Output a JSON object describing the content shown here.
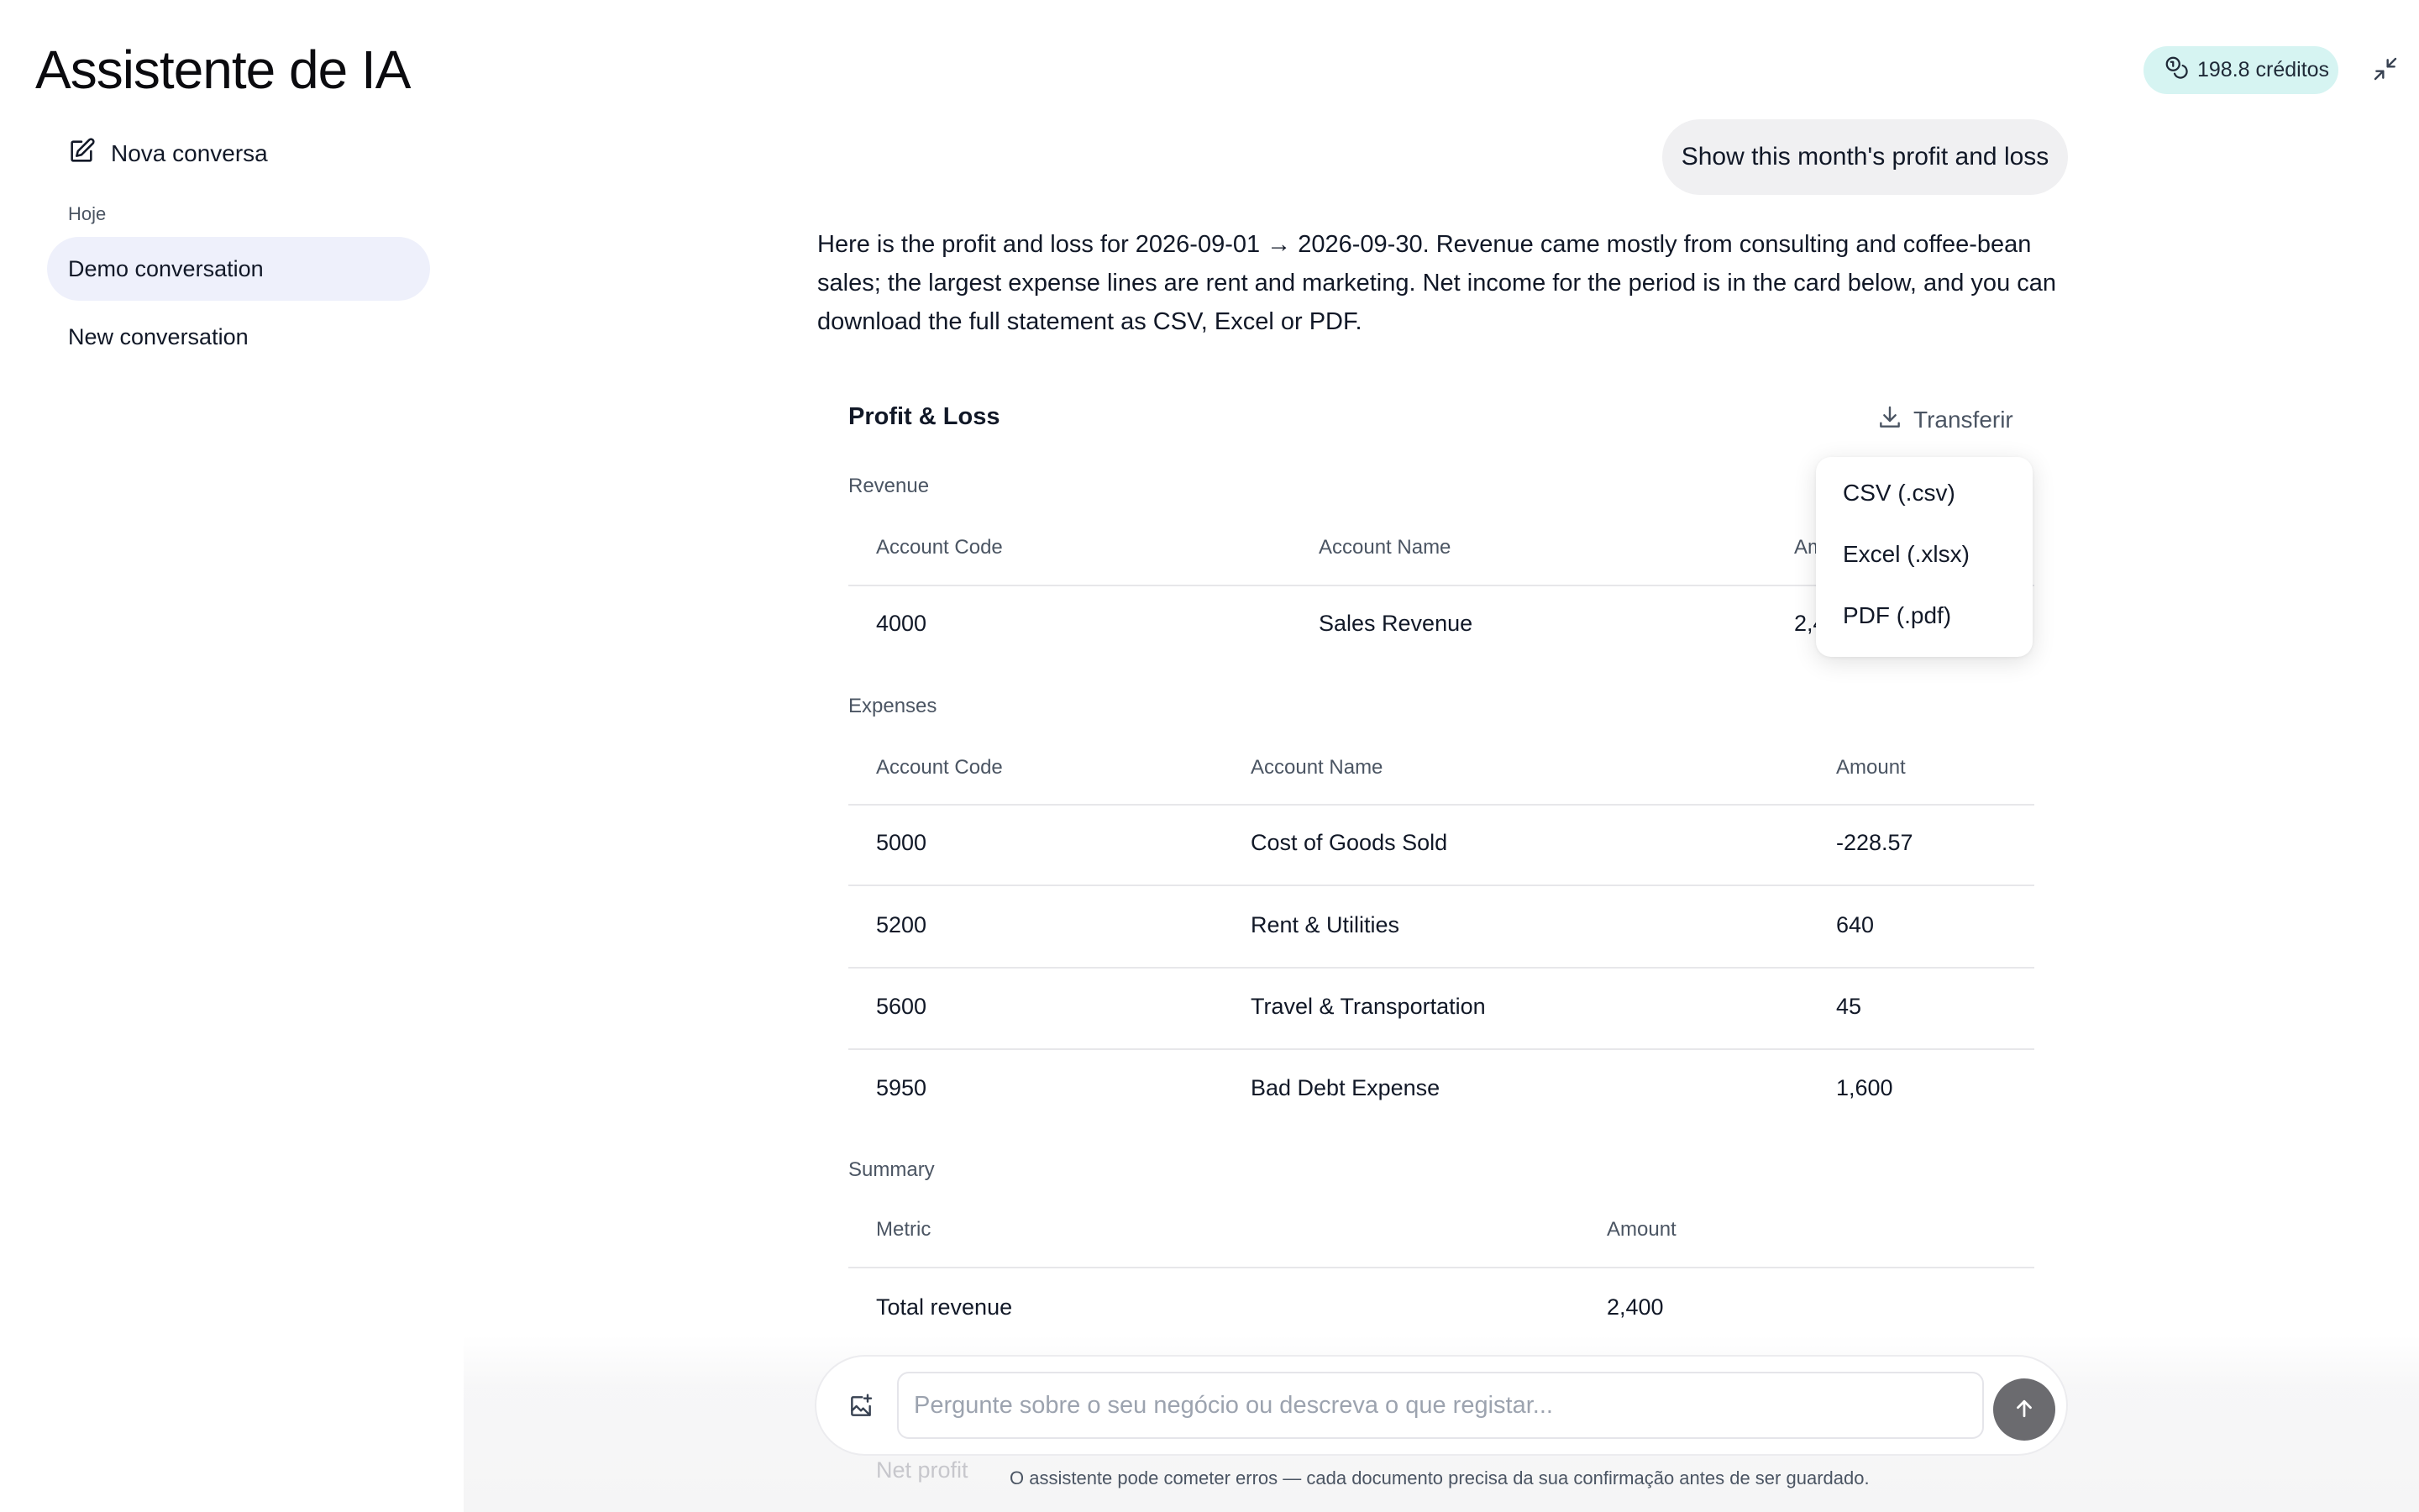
{
  "header": {
    "title": "Assistente de IA",
    "credits": "198.8 créditos",
    "icons": {
      "credits": "coins-icon",
      "minimize": "minimize-icon"
    }
  },
  "sidebar": {
    "new_chat_label": "Nova conversa",
    "section_label": "Hoje",
    "items": [
      {
        "label": "Demo conversation",
        "active": true
      },
      {
        "label": "New conversation",
        "active": false
      }
    ]
  },
  "chat": {
    "user_message": "Show this month's profit and loss",
    "assistant_message": "Here is the profit and loss for 2026-09-01 → 2026-09-30. Revenue came mostly from consulting and coffee-bean sales; the largest expense lines are rent and marketing. Net income for the period is in the card below, and you can download the full statement as CSV, Excel or PDF."
  },
  "report": {
    "title": "Profit & Loss",
    "download_label": "Transferir",
    "download_menu": [
      "CSV (.csv)",
      "Excel (.xlsx)",
      "PDF (.pdf)"
    ],
    "revenue": {
      "label": "Revenue",
      "headers": [
        "Account Code",
        "Account Name",
        "Am"
      ],
      "rows": [
        {
          "code": "4000",
          "name": "Sales Revenue",
          "amount": "2,4"
        }
      ]
    },
    "expenses": {
      "label": "Expenses",
      "headers": [
        "Account Code",
        "Account Name",
        "Amount"
      ],
      "rows": [
        {
          "code": "5000",
          "name": "Cost of Goods Sold",
          "amount": "-228.57"
        },
        {
          "code": "5200",
          "name": "Rent & Utilities",
          "amount": "640"
        },
        {
          "code": "5600",
          "name": "Travel & Transportation",
          "amount": "45"
        },
        {
          "code": "5950",
          "name": "Bad Debt Expense",
          "amount": "1,600"
        }
      ]
    },
    "summary": {
      "label": "Summary",
      "headers": [
        "Metric",
        "Amount"
      ],
      "rows": [
        {
          "metric": "Total revenue",
          "amount": "2,400"
        },
        {
          "metric": "Net profit"
        }
      ]
    }
  },
  "composer": {
    "placeholder": "Pergunte sobre o seu negócio ou descreva o que registar...",
    "value": "",
    "disclaimer": "O assistente pode cometer erros — cada documento precisa da sua confirmação antes de ser guardado."
  },
  "colors": {
    "credits_bg": "#d6f4f2",
    "active_item_bg": "#eef0fb",
    "send_button": "#6b6b6f"
  }
}
